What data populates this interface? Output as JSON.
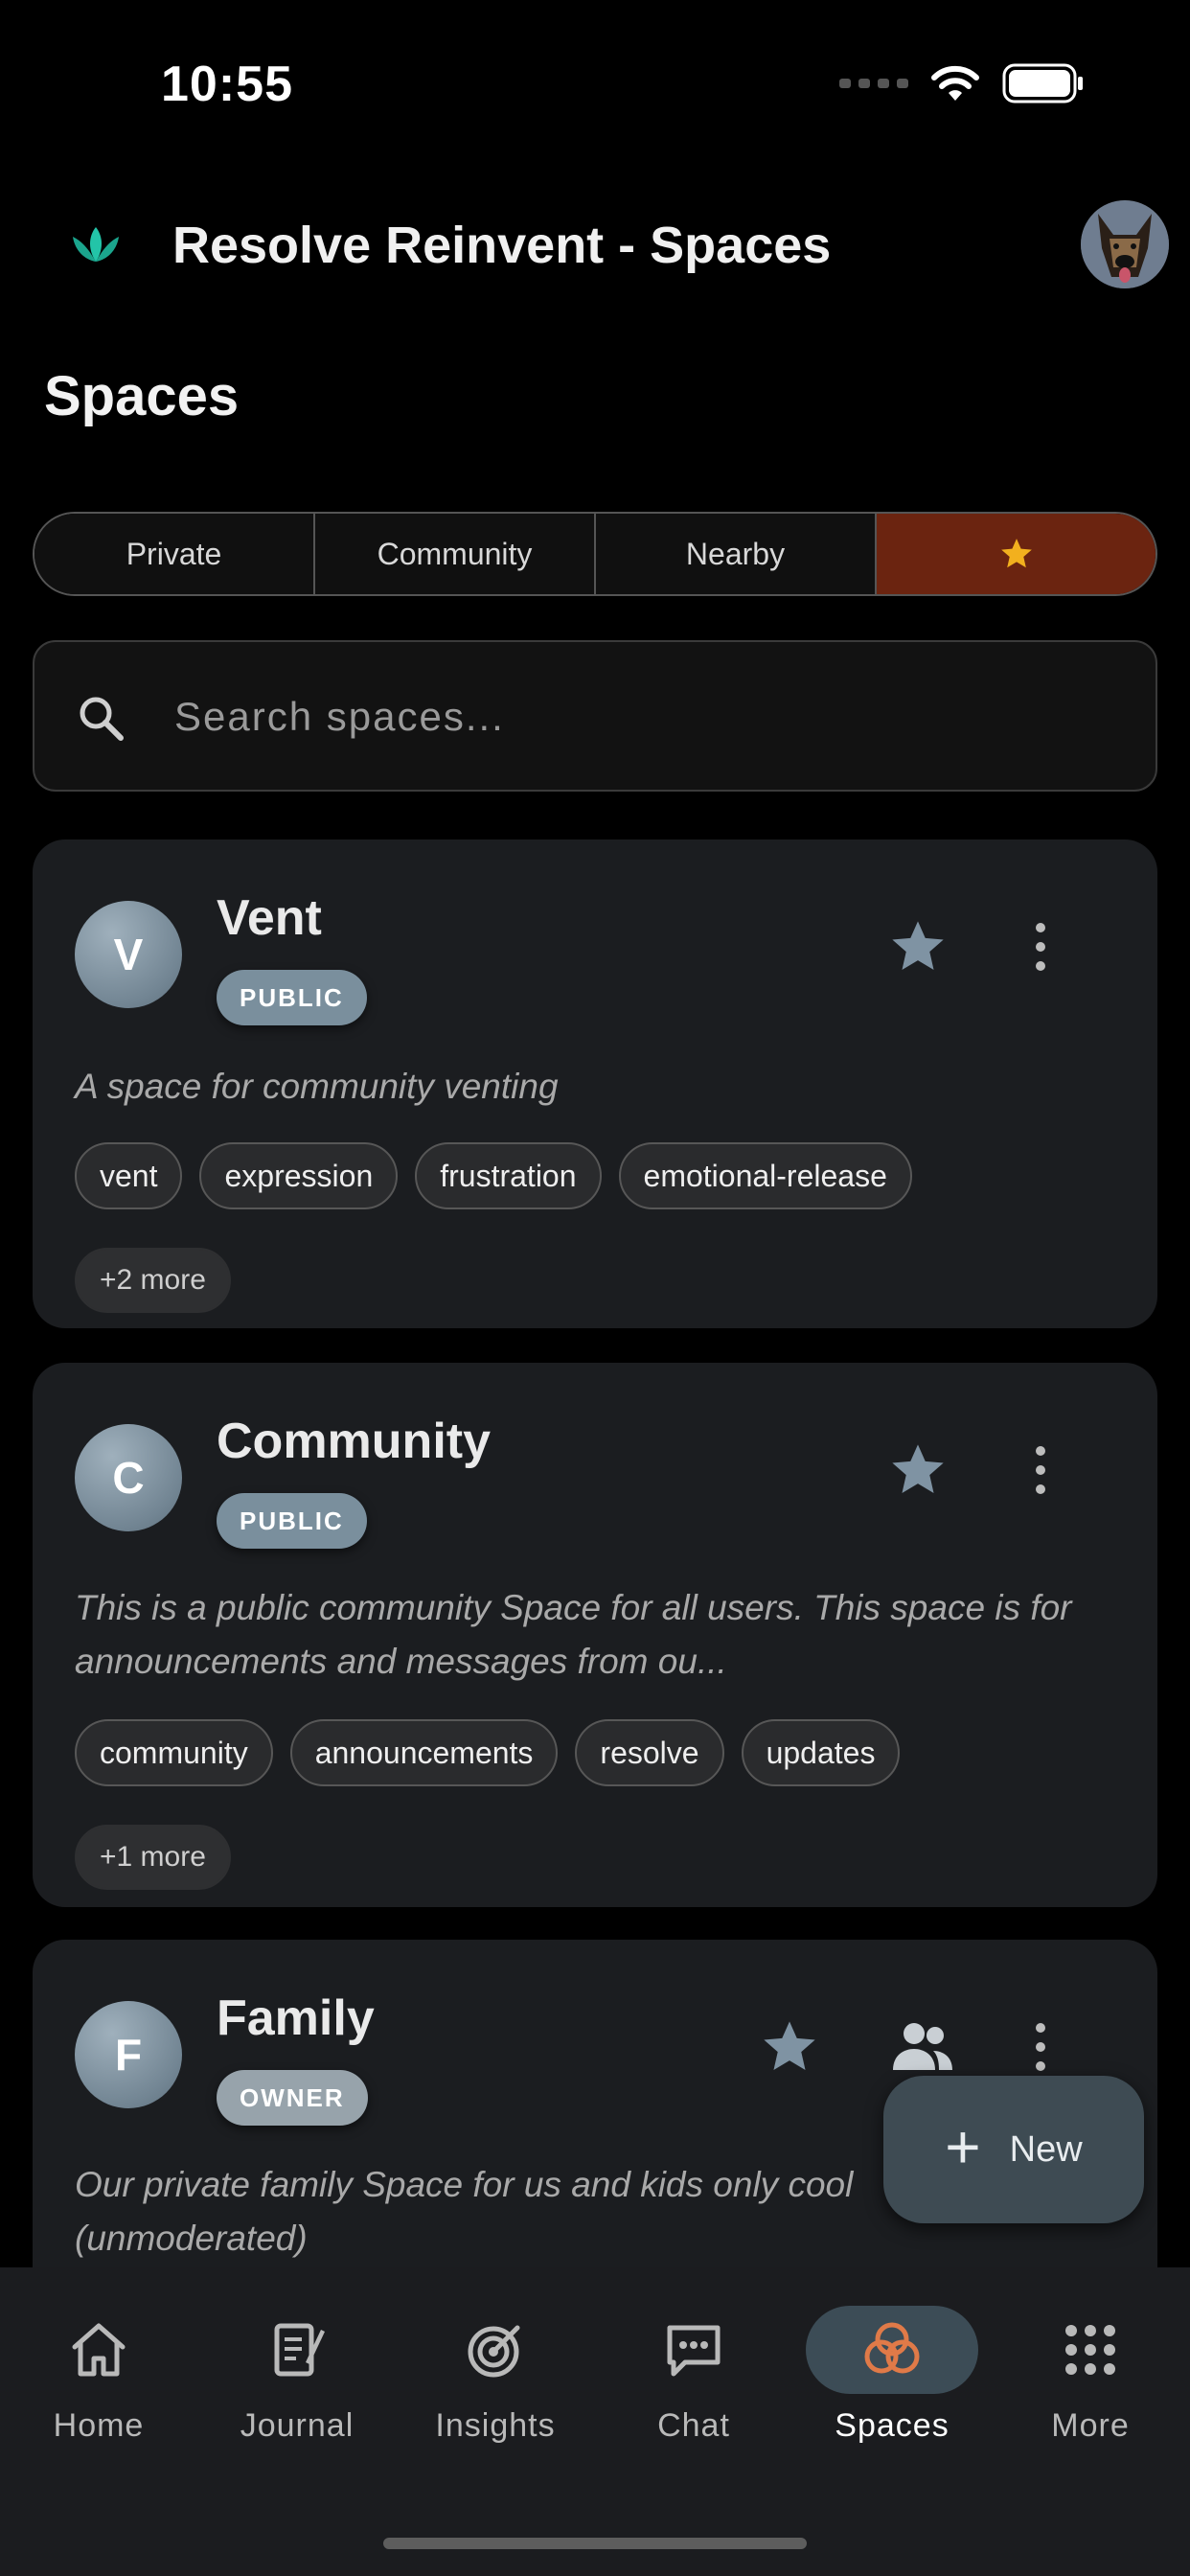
{
  "status_bar": {
    "time": "10:55"
  },
  "header": {
    "title": "Resolve Reinvent - Spaces"
  },
  "page_title": "Spaces",
  "segments": [
    {
      "label": "Private"
    },
    {
      "label": "Community"
    },
    {
      "label": "Nearby"
    },
    {
      "label": "",
      "icon": "star-icon",
      "active": true
    }
  ],
  "search": {
    "placeholder": "Search spaces...",
    "value": ""
  },
  "spaces": [
    {
      "initial": "V",
      "name": "Vent",
      "badge": "PUBLIC",
      "description": "A space for community venting",
      "tags": [
        "vent",
        "expression",
        "frustration",
        "emotional-release"
      ],
      "more": "+2 more"
    },
    {
      "initial": "C",
      "name": "Community",
      "badge": "PUBLIC",
      "description": "This is a public community Space for all users. This space is for announcements and messages from ou...",
      "tags": [
        "community",
        "announcements",
        "resolve",
        "updates"
      ],
      "more": "+1 more"
    },
    {
      "initial": "F",
      "name": "Family",
      "badge": "OWNER",
      "description": "Our private family Space for us and kids only cool (unmoderated)"
    }
  ],
  "fab": {
    "label": "New"
  },
  "nav": [
    {
      "label": "Home",
      "icon": "home-icon"
    },
    {
      "label": "Journal",
      "icon": "journal-icon"
    },
    {
      "label": "Insights",
      "icon": "target-icon"
    },
    {
      "label": "Chat",
      "icon": "chat-icon"
    },
    {
      "label": "Spaces",
      "icon": "spaces-icon",
      "active": true
    },
    {
      "label": "More",
      "icon": "grid-icon"
    }
  ],
  "colors": {
    "background": "#000000",
    "card": "#1b1d20",
    "accent_segment": "#6b2410",
    "star_active": "#f2b01e",
    "star_inactive": "#7f93a3",
    "teal_logo": "#23c4a8",
    "spaces_icon": "#e07a48"
  }
}
